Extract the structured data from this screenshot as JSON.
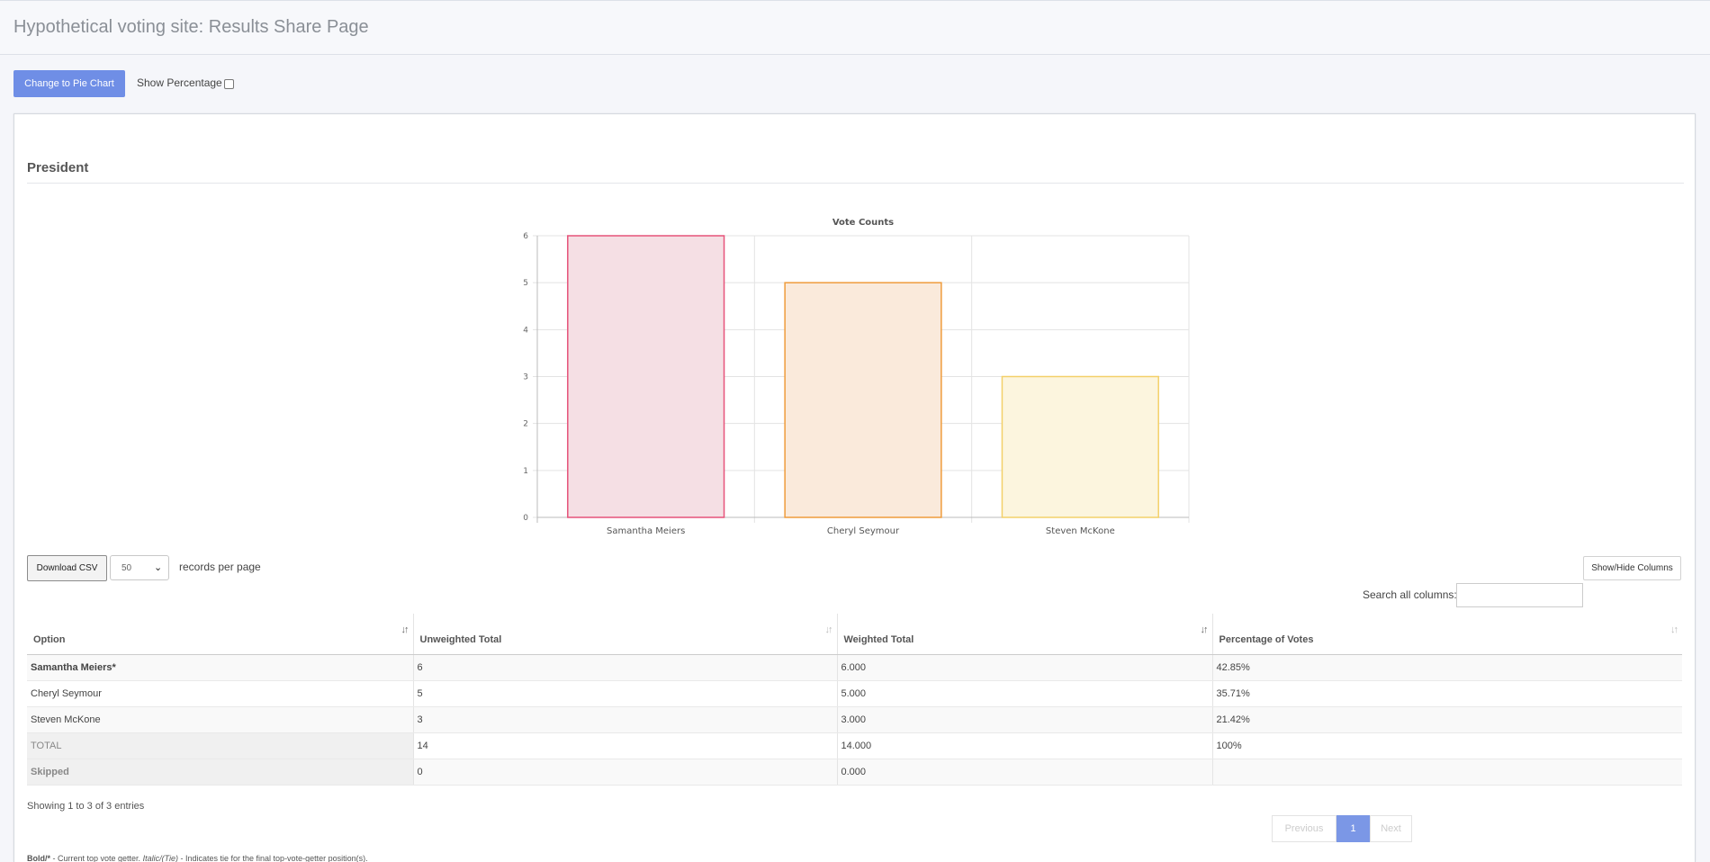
{
  "site": {
    "title": "Hypothetical voting site: Results Share Page"
  },
  "controls": {
    "chart_toggle_label": "Change to Pie Chart",
    "show_percentage_label": "Show Percentage",
    "show_percentage_checked": false
  },
  "section": {
    "title": "President"
  },
  "chart_data": {
    "type": "bar",
    "title": "Vote Counts",
    "categories": [
      "Samantha Meiers",
      "Cheryl Seymour",
      "Steven McKone"
    ],
    "values": [
      6,
      5,
      3
    ],
    "ylim": [
      0,
      6
    ],
    "yticks": [
      "0",
      "1",
      "2",
      "3",
      "4",
      "5",
      "6"
    ],
    "xlabel": "",
    "ylabel": "",
    "grid": true,
    "bar_fill_colors": [
      "#f5dfe4",
      "#faeadb",
      "#fcf5de"
    ],
    "bar_border_colors": [
      "#e6537a",
      "#ef9c3b",
      "#f3d06a"
    ]
  },
  "table_controls": {
    "download_csv_label": "Download CSV",
    "page_size": "50",
    "records_per_page_label": "records per page",
    "show_hide_columns_label": "Show/Hide Columns",
    "search_label": "Search all columns:",
    "search_value": ""
  },
  "table": {
    "columns": [
      "Option",
      "Unweighted Total",
      "Weighted Total",
      "Percentage of Votes"
    ],
    "rows": [
      [
        "Samantha Meiers*",
        "6",
        "6.000",
        "42.85%"
      ],
      [
        "Cheryl Seymour",
        "5",
        "5.000",
        "35.71%"
      ],
      [
        "Steven McKone",
        "3",
        "3.000",
        "21.42%"
      ]
    ],
    "total": [
      "TOTAL",
      "14",
      "14.000",
      "100%"
    ],
    "skipped": [
      "Skipped",
      "0",
      "0.000",
      ""
    ]
  },
  "pagination": {
    "info": "Showing 1 to 3 of 3 entries",
    "previous": "Previous",
    "current": "1",
    "next": "Next"
  },
  "footnote": {
    "bold_label": "Bold/*",
    "bold_text": " - Current top vote getter. ",
    "italic_label": "Italic/(Tie)",
    "italic_text": " - Indicates tie for the final top-vote-getter position(s)."
  },
  "colors": {
    "accent": "#6f8ee6"
  }
}
